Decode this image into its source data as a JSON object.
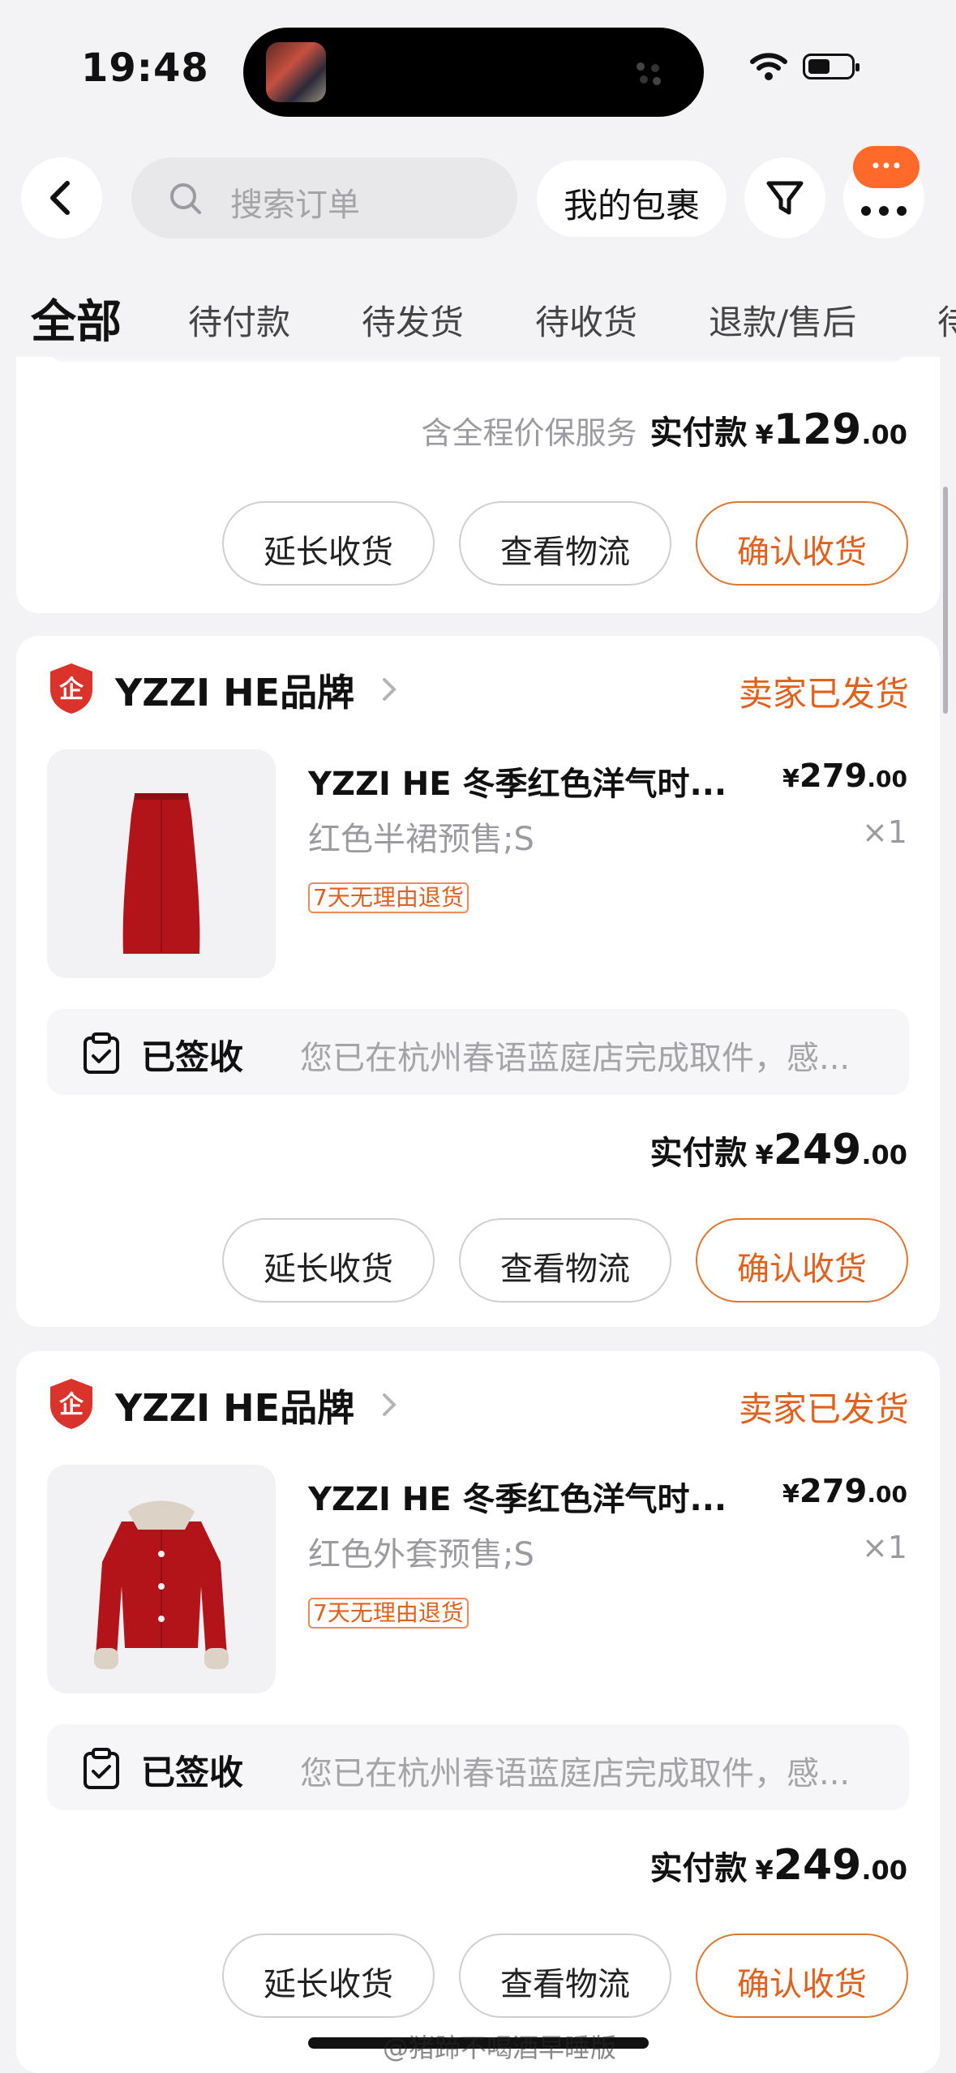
{
  "status_bar": {
    "time": "19:48"
  },
  "nav": {
    "search_placeholder": "搜索订单",
    "packages_label": "我的包裹"
  },
  "tabs": [
    {
      "label": "全部",
      "active": true
    },
    {
      "label": "待付款"
    },
    {
      "label": "待发货"
    },
    {
      "label": "待收货"
    },
    {
      "label": "退款/售后"
    },
    {
      "label": "待"
    }
  ],
  "order0": {
    "note": "含全程价保服务",
    "pay_label": "实付款",
    "pay_currency": "¥",
    "pay_int": "129",
    "pay_dec": ".00",
    "buttons": [
      "延长收货",
      "查看物流",
      "确认收货"
    ]
  },
  "order1": {
    "shop": "YZZI HE品牌",
    "status": "卖家已发货",
    "title": "YZZI HE 冬季红色洋气时...",
    "price_currency": "¥",
    "price_int": "279",
    "price_dec": ".00",
    "spec": "红色半裙预售;S",
    "qty": "×1",
    "tag": "7天无理由退货",
    "logistics_status": "已签收",
    "logistics_text": "您已在杭州春语蓝庭店完成取件，感...",
    "pay_label": "实付款",
    "pay_currency": "¥",
    "pay_int": "249",
    "pay_dec": ".00",
    "buttons": [
      "延长收货",
      "查看物流",
      "确认收货"
    ]
  },
  "order2": {
    "shop": "YZZI HE品牌",
    "status": "卖家已发货",
    "title": "YZZI HE 冬季红色洋气时...",
    "price_currency": "¥",
    "price_int": "279",
    "price_dec": ".00",
    "spec": "红色外套预售;S",
    "qty": "×1",
    "tag": "7天无理由退货",
    "logistics_status": "已签收",
    "logistics_text": "您已在杭州春语蓝庭店完成取件，感...",
    "pay_label": "实付款",
    "pay_currency": "¥",
    "pay_int": "249",
    "pay_dec": ".00",
    "buttons": [
      "延长收货",
      "查看物流",
      "确认收货"
    ]
  },
  "watermark": "@猪蹄不喝酒早睡版",
  "colors": {
    "accent": "#e0601c",
    "badge": "#ff6a2b",
    "product_red": "#b3141a"
  }
}
